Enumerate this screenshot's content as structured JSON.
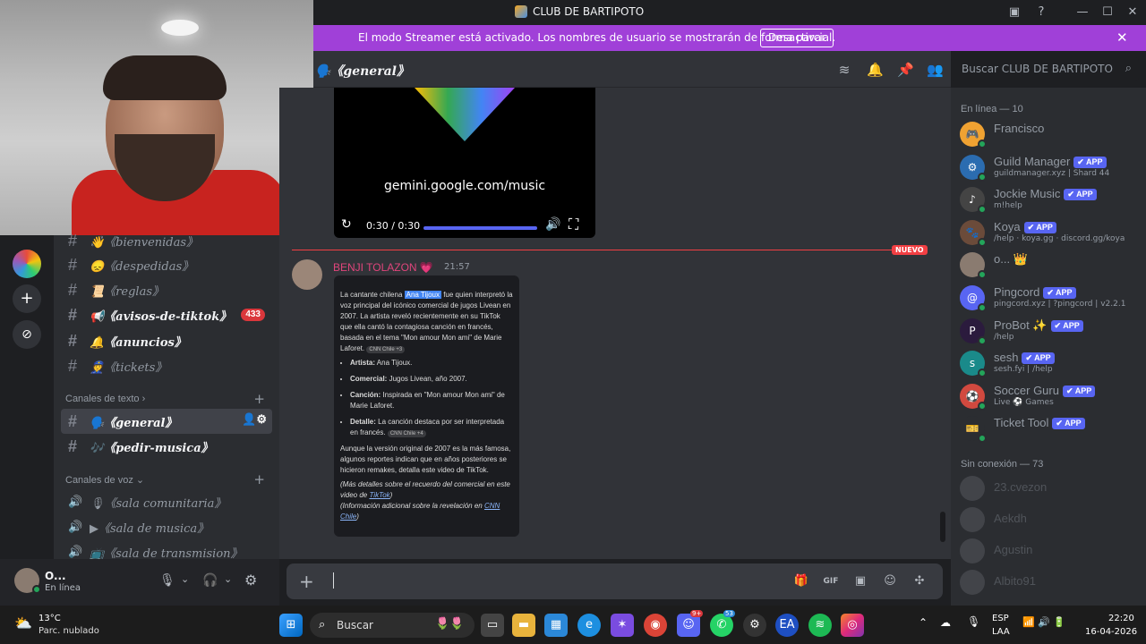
{
  "window": {
    "title": "CLUB DE BARTIPOTO"
  },
  "streamer": {
    "message": "El modo Streamer está activado. Los nombres de usuario se mostrarán de forma parcial.",
    "button": "Desactivar"
  },
  "channel_header": {
    "name": "🗣️《general》",
    "search_placeholder": "Buscar CLUB DE BARTIPOTO"
  },
  "sidebar": {
    "channels_top": [
      {
        "label": "👋《bienvenidas》"
      },
      {
        "label": "😞《despedidas》"
      },
      {
        "label": "📜《reglas》"
      },
      {
        "label": "📢《avisos-de-tiktok》",
        "badge": "433"
      },
      {
        "label": "🔔《anuncios》"
      },
      {
        "label": "👮《tickets》"
      }
    ],
    "text_category": "Canales de texto ›",
    "text_channels": [
      {
        "label": "🗣️《general》"
      },
      {
        "label": "🎶《pedir-musica》"
      }
    ],
    "voice_category": "Canales de voz ⌄",
    "voice_channels": [
      {
        "label": "🎙《sala comunitaria》"
      },
      {
        "label": "▶《sala de musica》"
      },
      {
        "label": "📺《sala de transmision》"
      }
    ]
  },
  "user": {
    "name": "O...",
    "status": "En línea"
  },
  "video": {
    "url_text": "gemini.google.com/music",
    "time": "0:30 / 0:30"
  },
  "divider": {
    "label": "NUEVO"
  },
  "message": {
    "author": "BENJI TOLAZON 💗",
    "time": "21:57",
    "card": {
      "intro_pre": "La cantante chilena ",
      "intro_hl": "Ana Tijoux",
      "intro_post": " fue quien interpretó la voz principal del icónico comercial de jugos Livean en 2007. La artista reveló recientemente en su TikTok que ella cantó la contagiosa canción en francés, basada en el tema \"Mon amour Mon ami\" de Marie Laforet.",
      "src1": "CNN Chile +3",
      "b1k": "Artista:",
      "b1v": " Ana Tijoux.",
      "b2k": "Comercial:",
      "b2v": " Jugos Livean, año 2007.",
      "b3k": "Canción:",
      "b3v": " Inspirada en \"Mon amour Mon ami\" de Marie Laforet.",
      "b4k": "Detalle:",
      "b4v": " La canción destaca por ser interpretada en francés.",
      "src2": "CNN Chile +4",
      "para2": "Aunque la versión original de 2007 es la más famosa, algunos reportes indican que en años posteriores se hicieron remakes, detalla este video de TikTok.",
      "it1_pre": "(Más detalles sobre el recuerdo del comercial en este video de ",
      "it1_link": "TikTok",
      "it1_post": ")",
      "it2_pre": "(Información adicional sobre la revelación en ",
      "it2_link": "CNN Chile",
      "it2_post": ")"
    }
  },
  "members": {
    "online_header": "En línea — 10",
    "online": [
      {
        "name": "Francisco",
        "sub": "",
        "app": "",
        "color": "#f0a232",
        "icon": "🎮"
      },
      {
        "name": "Guild Manager",
        "sub": "guildmanager.xyz | Shard 44",
        "app": "✔ APP",
        "color": "#2b6cb0",
        "icon": "⚙"
      },
      {
        "name": "Jockie Music",
        "sub": "m!help",
        "app": "✔ APP",
        "color": "#444",
        "icon": "♪"
      },
      {
        "name": "Koya",
        "sub": "/help · koya.gg · discord.gg/koya",
        "app": "✔ APP",
        "color": "#6b4b3a",
        "icon": "🐾"
      },
      {
        "name": "o... 👑",
        "sub": "",
        "app": "",
        "color": "#8a7b70",
        "icon": ""
      },
      {
        "name": "Pingcord",
        "sub": "pingcord.xyz | ?pingcord | v2.2.1",
        "app": "✔ APP",
        "color": "#5865f2",
        "icon": "@"
      },
      {
        "name": "ProBot ✨",
        "sub": "/help",
        "app": "✔ APP",
        "color": "#2b1b3d",
        "icon": "P"
      },
      {
        "name": "sesh",
        "sub": "sesh.fyi | /help",
        "app": "✔ APP",
        "color": "#1a8a8a",
        "icon": "s"
      },
      {
        "name": "Soccer Guru",
        "sub": "Live ⚽ Games",
        "app": "✔ APP",
        "color": "#d1493f",
        "icon": "⚽"
      },
      {
        "name": "Ticket Tool",
        "sub": "",
        "app": "✔ APP",
        "color": "#2b2d31",
        "icon": "🎫"
      }
    ],
    "offline_header": "Sin conexión — 73",
    "offline": [
      {
        "name": "23.cvezon"
      },
      {
        "name": "Aekdh"
      },
      {
        "name": "Agustin"
      },
      {
        "name": "Albito91"
      }
    ]
  },
  "taskbar": {
    "weather_temp": "13°C",
    "weather_desc": "Parc. nublado",
    "search": "Buscar",
    "lang1": "ESP",
    "lang2": "LAA",
    "clock_time": "22:20",
    "clock_date": "16-04-2026",
    "discord_badge": "9+",
    "whatsapp_badge": "53"
  }
}
